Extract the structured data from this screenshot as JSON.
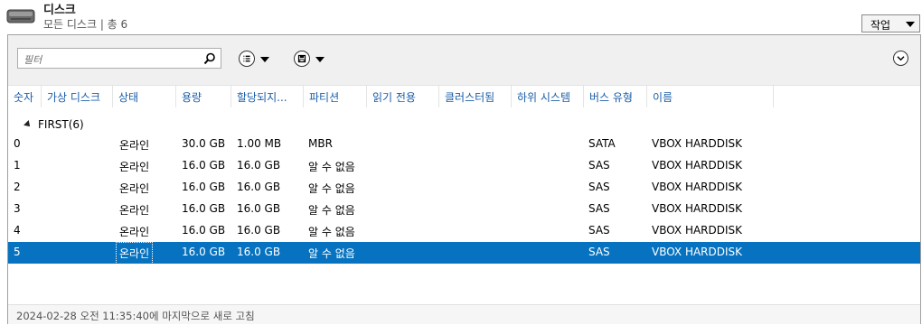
{
  "header": {
    "title": "디스크",
    "subtitle": "모든 디스크 | 총 6",
    "task_label": "작업"
  },
  "toolbar": {
    "filter_placeholder": "필터"
  },
  "columns": [
    "숫자",
    "가상 디스크",
    "상태",
    "용량",
    "할당되지...",
    "파티션",
    "읽기 전용",
    "클러스터됨",
    "하위 시스템",
    "버스 유형",
    "이름"
  ],
  "group": {
    "label": "FIRST(6)"
  },
  "rows": [
    {
      "number": "0",
      "state": "온라인",
      "capacity": "30.0 GB",
      "allocated": "1.00 MB",
      "partition": "MBR",
      "bus": "SATA",
      "name": "VBOX HARDDISK"
    },
    {
      "number": "1",
      "state": "온라인",
      "capacity": "16.0 GB",
      "allocated": "16.0 GB",
      "partition": "알 수 없음",
      "bus": "SAS",
      "name": "VBOX HARDDISK"
    },
    {
      "number": "2",
      "state": "온라인",
      "capacity": "16.0 GB",
      "allocated": "16.0 GB",
      "partition": "알 수 없음",
      "bus": "SAS",
      "name": "VBOX HARDDISK"
    },
    {
      "number": "3",
      "state": "온라인",
      "capacity": "16.0 GB",
      "allocated": "16.0 GB",
      "partition": "알 수 없음",
      "bus": "SAS",
      "name": "VBOX HARDDISK"
    },
    {
      "number": "4",
      "state": "온라인",
      "capacity": "16.0 GB",
      "allocated": "16.0 GB",
      "partition": "알 수 없음",
      "bus": "SAS",
      "name": "VBOX HARDDISK"
    },
    {
      "number": "5",
      "state": "온라인",
      "capacity": "16.0 GB",
      "allocated": "16.0 GB",
      "partition": "알 수 없음",
      "bus": "SAS",
      "name": "VBOX HARDDISK"
    }
  ],
  "selected_row": "5",
  "footer": {
    "status": "2024-02-28 오전 11:35:40에 마지막으로 새로 고침"
  },
  "icons": {
    "disk": "disk-icon",
    "search": "search-icon",
    "view": "list-view-icon",
    "save": "save-icon",
    "expand": "chevron-down-icon",
    "group_toggle": "collapse-triangle-icon"
  },
  "colors": {
    "selection": "#0773c0",
    "column_header_text": "#1a5ea8",
    "toolbar_bg": "#f0f0f0"
  }
}
